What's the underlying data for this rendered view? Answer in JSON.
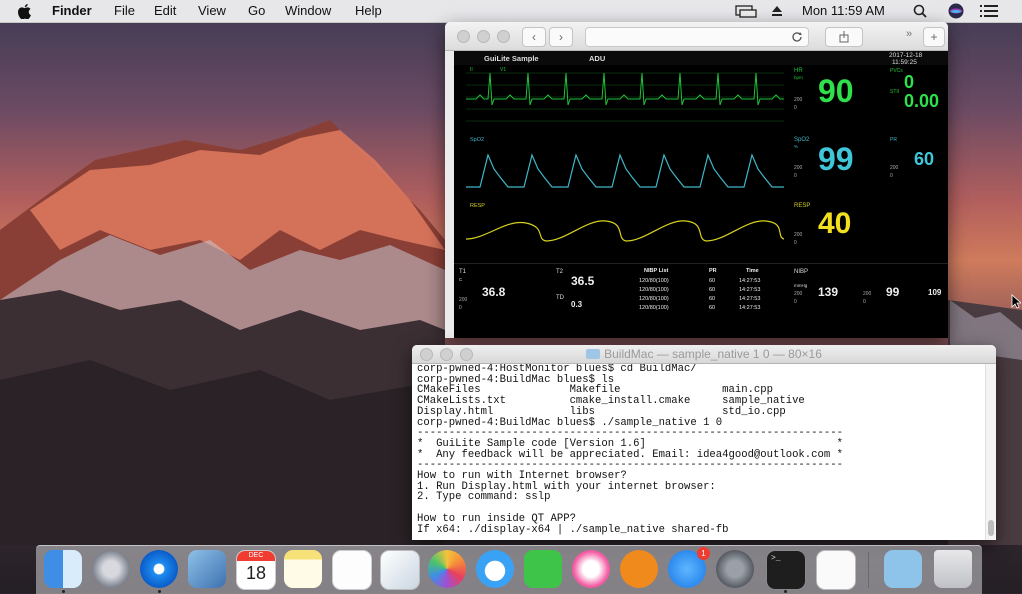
{
  "menubar": {
    "app_name": "Finder",
    "menus": [
      "File",
      "Edit",
      "View",
      "Go",
      "Window",
      "Help"
    ],
    "clock": "Mon 11:59 AM"
  },
  "monitor": {
    "title": "GuiLite Sample",
    "subtitle": "ADU",
    "date": "2017-12-18",
    "time": "11:59:25",
    "ecg_leads": [
      "II",
      "V1"
    ],
    "hr_label": "HR",
    "hr_unit": "bpm",
    "hr_scale_high": "200",
    "hr_scale_low": "0",
    "hr_value": "90",
    "pvcs_label": "PVCs",
    "pvcs_value": "0",
    "st_label": "STII",
    "st_value": "0.00",
    "spo2_wave_label": "SpO2",
    "spo2_label": "SpO2",
    "spo2_unit": "%",
    "spo2_scale_high": "200",
    "spo2_scale_low": "0",
    "spo2_value": "99",
    "pr_label": "PR",
    "pr_scale_high": "200",
    "pr_scale_low": "0",
    "pr_value": "60",
    "resp_wave_label": "RESP",
    "resp_label": "RESP",
    "resp_scale_high": "200",
    "resp_scale_low": "0",
    "resp_value": "40",
    "t1_label": "T1",
    "t1_unit": "C",
    "t1_scale_high": "200",
    "t1_scale_low": "0",
    "t1_value": "36.8",
    "t2_label": "T2",
    "t2_value": "36.5",
    "td_label": "TD",
    "td_value": "0.3",
    "nibp_list_header": [
      "NIBP List",
      "PR",
      "Time"
    ],
    "nibp_list_rows": [
      [
        "120/80(100)",
        "60",
        "14:27:53"
      ],
      [
        "120/80(100)",
        "60",
        "14:27:53"
      ],
      [
        "120/80(100)",
        "60",
        "14:27:53"
      ],
      [
        "120/80(100)",
        "60",
        "14:27:53"
      ]
    ],
    "nibp_label": "NIBP",
    "nibp_unit": "mmHg",
    "nibp_scale_high": "200",
    "nibp_scale_low": "0",
    "nibp_sys": "139",
    "nibp_mid_scale_high": "200",
    "nibp_mid_scale_low": "0",
    "nibp_dia": "99",
    "nibp_map": "109"
  },
  "terminal": {
    "title": "BuildMac — sample_native 1 0 — 80×16",
    "lines": [
      "corp-pwned-4:HostMonitor blues$ cd BuildMac/",
      "corp-pwned-4:BuildMac blues$ ls",
      "CMakeFiles              Makefile                main.cpp",
      "CMakeLists.txt          cmake_install.cmake     sample_native",
      "Display.html            libs                    std_io.cpp",
      "corp-pwned-4:BuildMac blues$ ./sample_native 1 0",
      "-------------------------------------------------------------------",
      "*  GuiLite Sample code [Version 1.6]                              *",
      "*  Any feedback will be appreciated. Email: idea4good@outlook.com *",
      "-------------------------------------------------------------------",
      "How to run with Internet browser?",
      "1. Run Display.html with your internet browser:",
      "2. Type command: sslp",
      "",
      "How to run inside QT APP?",
      "If x64: ./display-x64 | ./sample_native shared-fb"
    ]
  },
  "dock": {
    "calendar_month": "DEC",
    "calendar_day": "18",
    "appstore_badge": "1"
  }
}
